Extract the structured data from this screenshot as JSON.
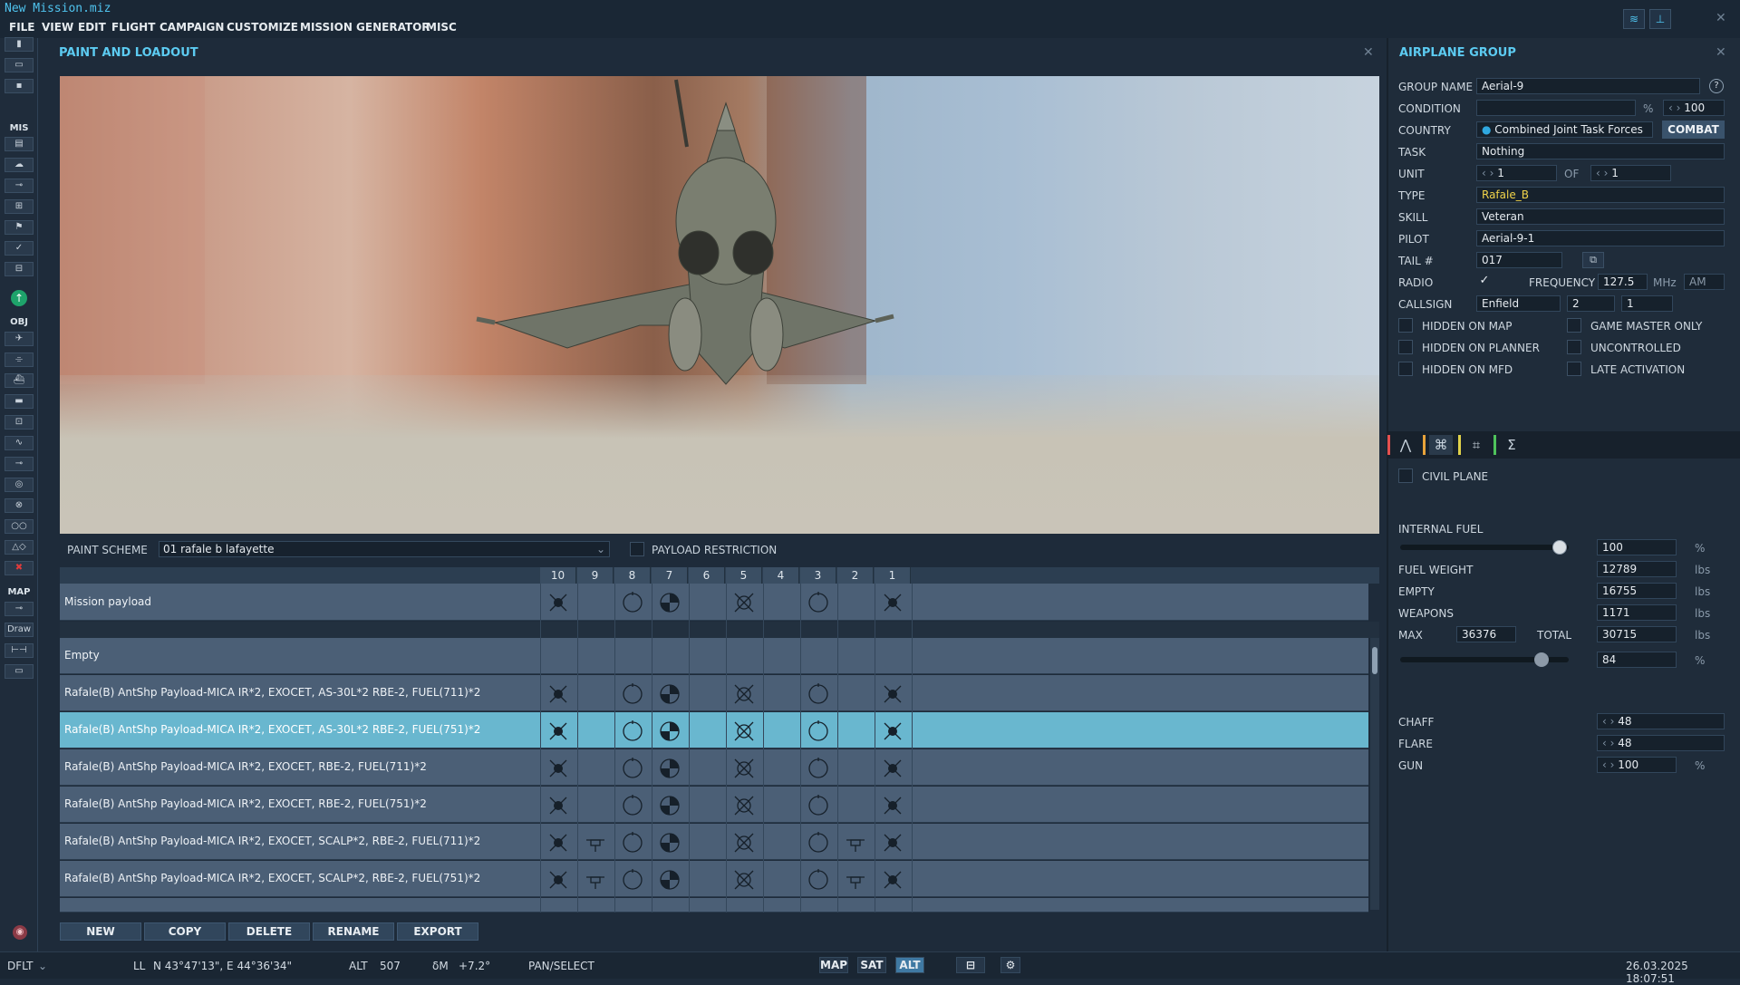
{
  "window": {
    "title": "New Mission.miz"
  },
  "menu": [
    "FILE",
    "VIEW",
    "EDIT",
    "FLIGHT",
    "CAMPAIGN",
    "CUSTOMIZE",
    "MISSION GENERATOR",
    "MISC"
  ],
  "left_toolbar": {
    "mis_label": "MIS",
    "obj_label": "OBJ",
    "map_label": "MAP",
    "draw_label": "Draw"
  },
  "paint_panel": {
    "title": "PAINT AND LOADOUT",
    "paint_scheme_label": "PAINT SCHEME",
    "paint_scheme_value": "01 rafale b lafayette",
    "payload_restriction_label": "PAYLOAD RESTRICTION",
    "pylons": [
      "10",
      "9",
      "8",
      "7",
      "6",
      "5",
      "4",
      "3",
      "2",
      "1"
    ],
    "mission_payload_label": "Mission payload",
    "loadouts": [
      "Empty",
      "Rafale(B) AntShp Payload-MICA IR*2, EXOCET, AS-30L*2 RBE-2, FUEL(711)*2",
      "Rafale(B) AntShp Payload-MICA IR*2, EXOCET, AS-30L*2 RBE-2, FUEL(751)*2",
      "Rafale(B) AntShp Payload-MICA IR*2, EXOCET, RBE-2, FUEL(711)*2",
      "Rafale(B) AntShp Payload-MICA IR*2, EXOCET, RBE-2, FUEL(751)*2",
      "Rafale(B) AntShp Payload-MICA IR*2, EXOCET, SCALP*2, RBE-2, FUEL(711)*2",
      "Rafale(B) AntShp Payload-MICA IR*2, EXOCET, SCALP*2, RBE-2, FUEL(751)*2"
    ],
    "buttons": {
      "new": "NEW",
      "copy": "COPY",
      "delete": "DELETE",
      "rename": "RENAME",
      "export": "EXPORT"
    }
  },
  "group_panel": {
    "title": "AIRPLANE GROUP",
    "group_name_label": "GROUP NAME",
    "group_name": "Aerial-9",
    "condition_label": "CONDITION",
    "condition_unit": "%",
    "condition_value": "100",
    "country_label": "COUNTRY",
    "country": "Combined Joint Task Forces",
    "combat_button": "COMBAT",
    "task_label": "TASK",
    "task": "Nothing",
    "unit_label": "UNIT",
    "unit": "1",
    "of_label": "OF",
    "unit_of": "1",
    "type_label": "TYPE",
    "type": "Rafale_B",
    "skill_label": "SKILL",
    "skill": "Veteran",
    "pilot_label": "PILOT",
    "pilot": "Aerial-9-1",
    "tail_label": "TAIL #",
    "tail": "017",
    "radio_label": "RADIO",
    "frequency_label": "FREQUENCY",
    "frequency": "127.5",
    "freq_unit": "MHz",
    "modulation": "AM",
    "callsign_label": "CALLSIGN",
    "callsign": "Enfield",
    "callsign_n1": "2",
    "callsign_n2": "1",
    "hidden_map": "HIDDEN ON MAP",
    "hidden_planner": "HIDDEN ON PLANNER",
    "hidden_mfd": "HIDDEN ON MFD",
    "game_master": "GAME MASTER ONLY",
    "uncontrolled": "UNCONTROLLED",
    "late_activation": "LATE ACTIVATION",
    "civil_plane": "CIVIL PLANE",
    "internal_fuel_label": "INTERNAL FUEL",
    "internal_fuel": "100",
    "internal_fuel_fraction": 1.0,
    "fuel_weight_label": "FUEL WEIGHT",
    "fuel_weight": "12789",
    "empty_label": "EMPTY",
    "empty": "16755",
    "weapons_label": "WEAPONS",
    "weapons": "1171",
    "max_label": "MAX",
    "max": "36376",
    "total_label": "TOTAL",
    "total": "30715",
    "load_percent": "84",
    "load_fraction": 0.84,
    "lbs": "lbs",
    "pct": "%",
    "chaff_label": "CHAFF",
    "chaff": "48",
    "flare_label": "FLARE",
    "flare": "48",
    "gun_label": "GUN",
    "gun": "100"
  },
  "status_bar": {
    "profile": "DFLT",
    "ll_label": "LL",
    "coords": "N 43°47'13\", E 44°36'34\"",
    "alt_label": "ALT",
    "alt": "507",
    "dm_label": "δM",
    "dm": "+7.2°",
    "mode": "PAN/SELECT",
    "map_btn": "MAP",
    "sat_btn": "SAT",
    "alt_btn": "ALT",
    "datetime": "26.03.2025 18:07:51"
  }
}
